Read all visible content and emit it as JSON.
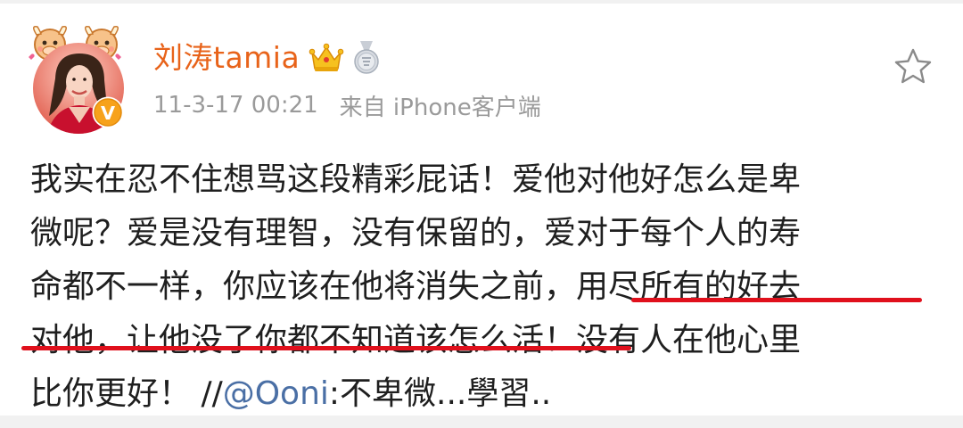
{
  "user": {
    "name": "刘涛tamia",
    "timestamp": "11-3-17 00:21",
    "source": "来自 iPhone客户端"
  },
  "post": {
    "line1": "我实在忍不住想骂这段精彩屁话！爱他对他好怎么是卑",
    "line2": "微呢？爱是没有理智，没有保留的，爱对于每个人的寿",
    "line3_a": "命都不一样，你应该在他将消失之前，",
    "line3_b": "用尽所有的好去",
    "line4_a": "对他，让他没了你都不知道该怎么活！",
    "line4_b": "没有人在他心里",
    "line5_a": "比你更好！ //",
    "line5_mention": "@Ooni",
    "line5_b": ":不卑微...學習.."
  },
  "icons": {
    "crown": "crown-vip-icon",
    "medal": "medal-badge-icon",
    "favorite": "star-outline-icon",
    "verified": "verified-v-badge-icon"
  },
  "colors": {
    "name": "#e8631a",
    "meta": "#9a9a9a",
    "mention": "#4a6fa5",
    "underline": "#e0101c",
    "text": "#1f1f1f"
  }
}
